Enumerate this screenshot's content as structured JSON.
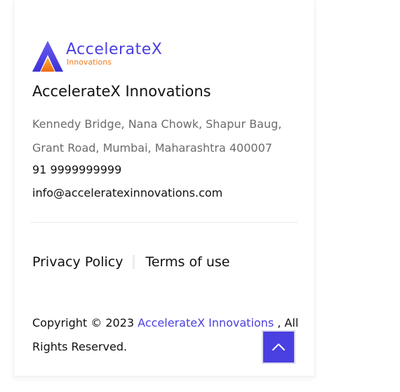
{
  "logo": {
    "wordmark": "AccelerateX",
    "tagline": "Innovations"
  },
  "company": {
    "name": "AccelerateX Innovations",
    "address_line1": "Kennedy Bridge, Nana Chowk, Shapur Baug,",
    "address_line2": "Grant Road, Mumbai, Maharashtra 400007",
    "phone": "91 9999999999",
    "email": "info@acceleratexinnovations.com"
  },
  "links": {
    "privacy": "Privacy Policy",
    "terms": "Terms of use"
  },
  "copyright": {
    "prefix": "Copyright © 2023",
    "brand": "AccelerateX Innovations",
    "suffix": ", All Rights Reserved."
  },
  "icons": {
    "logo_mark": "triangle-a-logo-icon",
    "scroll_top": "chevron-up-icon"
  },
  "colors": {
    "brand_primary": "#4a3fe0",
    "brand_accent": "#f07a1a",
    "text_dark": "#111111",
    "text_muted": "#6b6b6b"
  }
}
